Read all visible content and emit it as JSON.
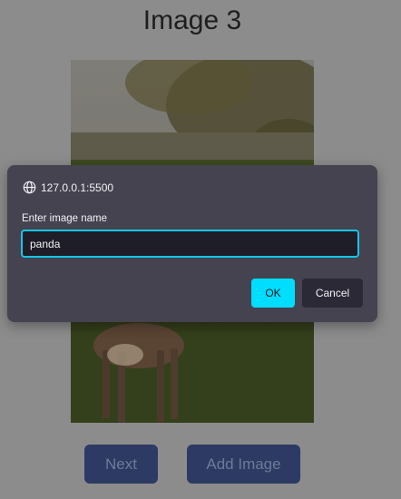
{
  "page": {
    "title": "Image 3"
  },
  "gallery": {
    "image_alt": "deer",
    "next_label": "Next",
    "add_label": "Add Image"
  },
  "dialog": {
    "origin": "127.0.0.1:5500",
    "prompt": "Enter image name",
    "input_value": "panda",
    "ok_label": "OK",
    "cancel_label": "Cancel",
    "accent_color": "#00ddff"
  },
  "icons": {
    "origin": "globe-icon"
  }
}
